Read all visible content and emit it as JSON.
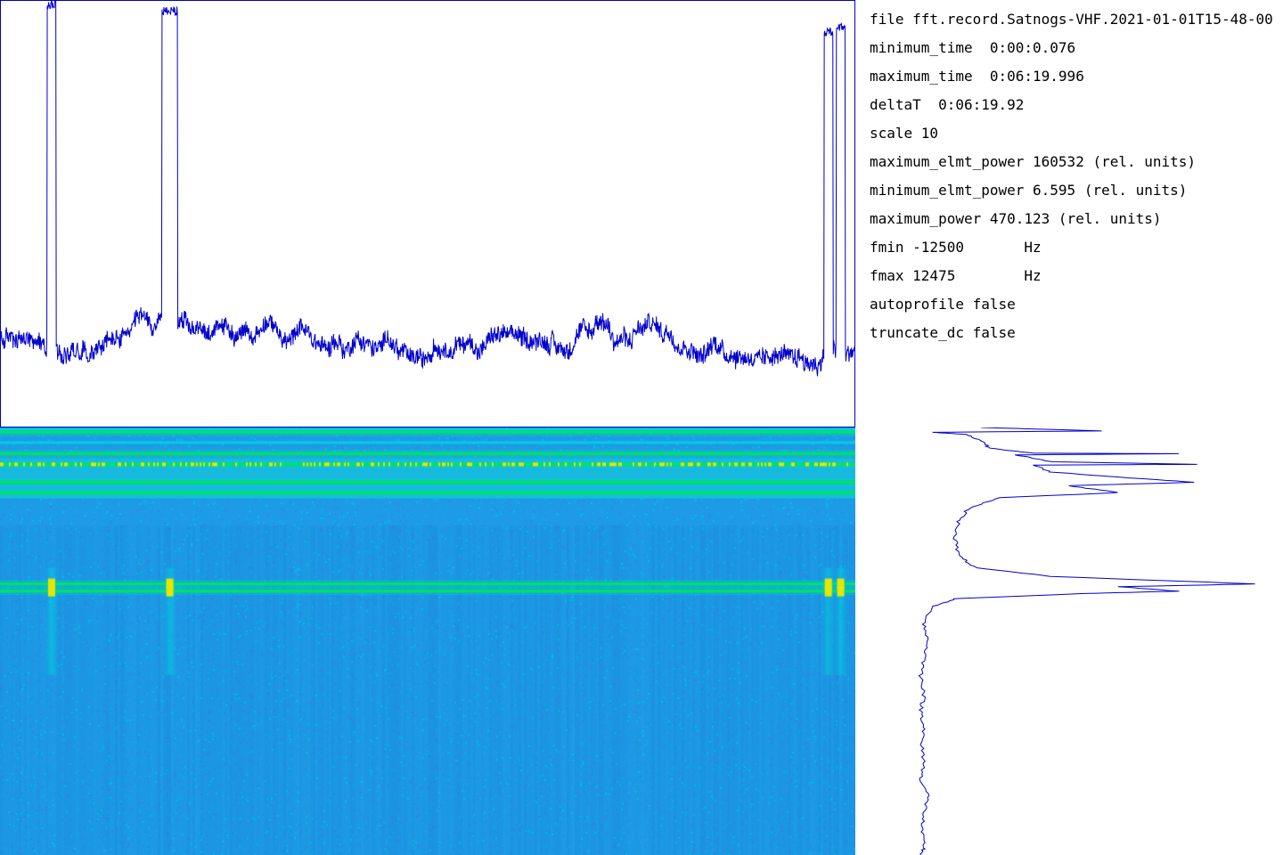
{
  "info": {
    "lines": [
      "file fft.record.Satnogs-VHF.2021-01-01T15-48-00",
      "minimum_time  0:00:0.076",
      "maximum_time  0:06:19.996",
      "deltaT  0:06:19.92",
      "scale 10",
      "maximum_elmt_power 160532 (rel. units)",
      "minimum_elmt_power 6.595 (rel. units)",
      "maximum_power 470.123 (rel. units)",
      "fmin -12500       Hz",
      "fmax 12475        Hz",
      "autoprofile false",
      "truncate_dc false"
    ]
  },
  "colors": {
    "trace": "#0000cc",
    "frame": "#0000cc",
    "waterfall_base": "#1e9be6",
    "waterfall_band": "#00e070",
    "waterfall_hot": "#e6e600",
    "waterfall_cyan": "#00cce6"
  },
  "chart_data": [
    {
      "type": "line",
      "name": "time-power",
      "x_range": [
        0.076,
        379.996
      ],
      "x_unit": "s",
      "ylim": [
        0,
        470.123
      ],
      "baseline_level": 95,
      "bursts": [
        {
          "t_start": 21.0,
          "t_end": 25.0,
          "level": 465
        },
        {
          "t_start": 72.0,
          "t_end": 79.0,
          "level": 458
        },
        {
          "t_start": 366.0,
          "t_end": 370.0,
          "level": 435
        },
        {
          "t_start": 371.5,
          "t_end": 375.5,
          "level": 440
        }
      ]
    },
    {
      "type": "heatmap",
      "name": "waterfall",
      "x_range": [
        0.076,
        379.996
      ],
      "y_range": [
        -12500,
        12475
      ],
      "y_unit": "Hz",
      "horizontal_bands_hz": [
        -12222,
        -10972,
        -10347,
        -9305,
        -8680,
        -3361,
        -2944
      ],
      "burst_times_s": [
        23.0,
        75.5,
        368.0,
        373.5
      ]
    },
    {
      "type": "line",
      "name": "frequency-profile",
      "y_range": [
        -12500,
        12475
      ],
      "y_unit": "Hz",
      "profile": [
        [
          -12500,
          0.2
        ],
        [
          -12300,
          0.55
        ],
        [
          -12220,
          0.05
        ],
        [
          -12100,
          0.15
        ],
        [
          -11700,
          0.2
        ],
        [
          -11300,
          0.22
        ],
        [
          -11000,
          0.35
        ],
        [
          -10970,
          0.77
        ],
        [
          -10900,
          0.3
        ],
        [
          -10500,
          0.4
        ],
        [
          -10350,
          0.83
        ],
        [
          -10300,
          0.35
        ],
        [
          -9900,
          0.4
        ],
        [
          -9600,
          0.6
        ],
        [
          -9300,
          0.82
        ],
        [
          -9100,
          0.45
        ],
        [
          -8700,
          0.6
        ],
        [
          -8400,
          0.25
        ],
        [
          -7800,
          0.16
        ],
        [
          -7000,
          0.13
        ],
        [
          -6000,
          0.12
        ],
        [
          -5000,
          0.13
        ],
        [
          -4300,
          0.18
        ],
        [
          -3800,
          0.4
        ],
        [
          -3360,
          1.0
        ],
        [
          -3200,
          0.6
        ],
        [
          -2940,
          0.77
        ],
        [
          -2800,
          0.5
        ],
        [
          -2500,
          0.12
        ],
        [
          -2000,
          0.05
        ],
        [
          -1000,
          0.03
        ],
        [
          0,
          0.04
        ],
        [
          1000,
          0.03
        ],
        [
          2000,
          0.02
        ],
        [
          3000,
          0.03
        ],
        [
          4000,
          0.02
        ],
        [
          5000,
          0.03
        ],
        [
          6000,
          0.02
        ],
        [
          7000,
          0.03
        ],
        [
          8000,
          0.02
        ],
        [
          9000,
          0.04
        ],
        [
          10000,
          0.03
        ],
        [
          11000,
          0.02
        ],
        [
          12000,
          0.03
        ],
        [
          12475,
          0.02
        ]
      ]
    }
  ]
}
